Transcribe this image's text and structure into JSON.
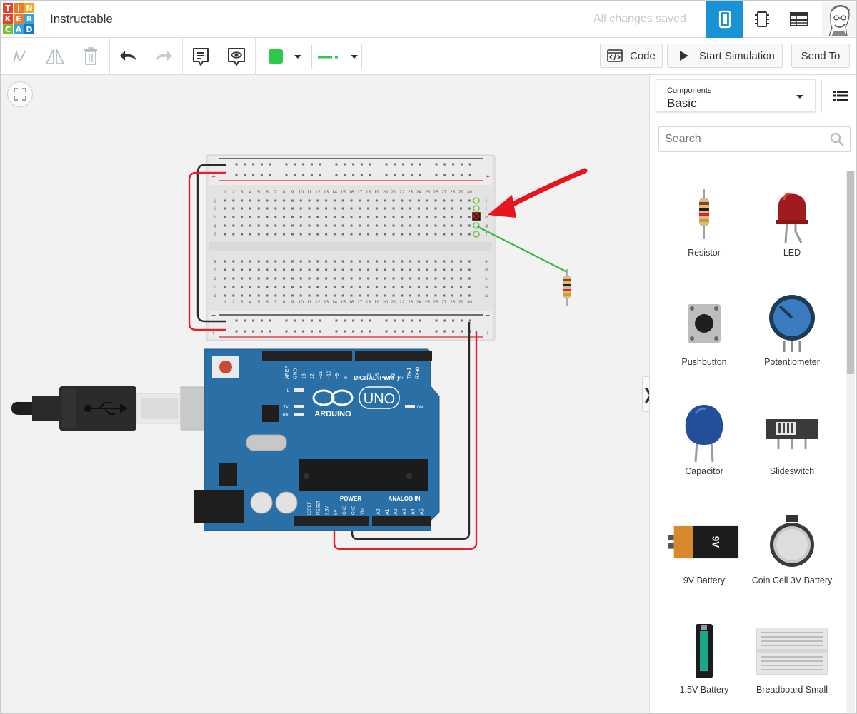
{
  "app": {
    "logo_letters": [
      "T",
      "I",
      "N",
      "K",
      "E",
      "R",
      "C",
      "A",
      "D"
    ],
    "logo_colors": [
      "#e8412c",
      "#ee7a2b",
      "#f5a623",
      "#e8412c",
      "#ee7a2b",
      "#2ba8e0",
      "#7bbf3c",
      "#2ba8e0",
      "#1b75bb"
    ],
    "project_title": "Instructable",
    "save_status": "All changes saved",
    "accent_color": "#1a93d6"
  },
  "header_views": [
    {
      "name": "circuit-view",
      "icon": "breadboard-icon",
      "active": true
    },
    {
      "name": "schematic-view",
      "icon": "chip-icon",
      "active": false
    },
    {
      "name": "component-list-view",
      "icon": "table-icon",
      "active": false
    }
  ],
  "toolbar": {
    "tools": [
      "rotate-icon",
      "flip-icon",
      "trash-icon",
      "undo-icon",
      "redo-icon",
      "notes-icon",
      "visibility-icon"
    ],
    "fill_color": "#2ec84a",
    "wire_color": "#2ec84a",
    "code_label": "Code",
    "simulate_label": "Start Simulation",
    "send_label": "Send To"
  },
  "panel": {
    "components_label": "Components",
    "components_value": "Basic",
    "search_placeholder": "Search",
    "items": [
      {
        "label": "Resistor",
        "icon": "resistor-icon"
      },
      {
        "label": "LED",
        "icon": "led-icon"
      },
      {
        "label": "Pushbutton",
        "icon": "pushbutton-icon"
      },
      {
        "label": "Potentiometer",
        "icon": "potentiometer-icon"
      },
      {
        "label": "Capacitor",
        "icon": "capacitor-icon"
      },
      {
        "label": "Slideswitch",
        "icon": "slideswitch-icon"
      },
      {
        "label": "9V Battery",
        "icon": "battery-9v-icon"
      },
      {
        "label": "Coin Cell 3V Battery",
        "icon": "coin-cell-icon"
      },
      {
        "label": "1.5V Battery",
        "icon": "battery-aa-icon"
      },
      {
        "label": "Breadboard Small",
        "icon": "breadboard-small-icon"
      }
    ]
  },
  "canvas": {
    "breadboard": {
      "column_numbers": [
        "1",
        "2",
        "3",
        "4",
        "5",
        "6",
        "7",
        "8",
        "9",
        "10",
        "11",
        "12",
        "13",
        "14",
        "15",
        "16",
        "17",
        "18",
        "19",
        "20",
        "21",
        "22",
        "23",
        "24",
        "25",
        "26",
        "27",
        "28",
        "29",
        "30"
      ],
      "rows_top": [
        "j",
        "i",
        "h",
        "g",
        "f"
      ],
      "rows_bottom": [
        "e",
        "d",
        "c",
        "b",
        "a"
      ],
      "rail_minus": "−",
      "rail_plus": "+"
    },
    "arduino": {
      "brand": "ARDUINO",
      "model": "UNO",
      "digital_label": "DIGITAL (PWM~)",
      "power_label": "POWER",
      "analog_label": "ANALOG IN",
      "on_label": "ON",
      "led_labels": [
        "L",
        "TX",
        "RX"
      ],
      "digital_pins": [
        "AREF",
        "GND",
        "13",
        "12",
        "~11",
        "~10",
        "~9",
        "8",
        "7",
        "~6",
        "~5",
        "4",
        "~3",
        "2",
        "TX▸1",
        "RX◂0"
      ],
      "power_pins": [
        "IOREF",
        "RESET",
        "3.3V",
        "5V",
        "GND",
        "GND",
        "Vin"
      ],
      "analog_pins": [
        "A0",
        "A1",
        "A2",
        "A3",
        "A4",
        "A5"
      ]
    },
    "wire_colors": {
      "ground": "#2b2b2b",
      "power": "#e0242a",
      "signal": "#3cb54a"
    },
    "annotation_arrow_color": "#e8141e"
  }
}
